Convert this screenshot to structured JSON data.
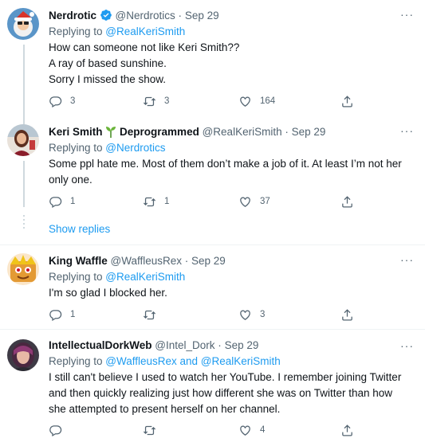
{
  "colors": {
    "accent": "#1d9bf0",
    "muted": "#536471",
    "text": "#0f1419"
  },
  "tweets": [
    {
      "name": "Nerdrotic",
      "handle": "@Nerdrotics",
      "dot": "·",
      "date": "Sep 29",
      "reply_prefix": "Replying to ",
      "reply_to": "@RealKeriSmith",
      "lines": [
        "How can someone not like Keri Smith??",
        "A ray of based sunshine.",
        "Sorry I missed the show."
      ],
      "replies": "3",
      "retweets": "3",
      "likes": "164",
      "badge": "verified-icon"
    },
    {
      "name": "Keri Smith",
      "name_suffix": "Deprogrammed",
      "handle": "@RealKeriSmith",
      "dot": "·",
      "date": "Sep 29",
      "reply_prefix": "Replying to ",
      "reply_to": "@Nerdrotics",
      "lines": [
        "Some ppl hate me. Most of them don’t make a job of it. At least I’m not her",
        "only one."
      ],
      "replies": "1",
      "retweets": "1",
      "likes": "37"
    },
    {
      "name": "King Waffle",
      "handle": "@WaffleusRex",
      "dot": "·",
      "date": "Sep 29",
      "reply_prefix": "Replying to ",
      "reply_to": "@RealKeriSmith",
      "lines": [
        "I'm so glad I blocked her."
      ],
      "replies": "1",
      "retweets": "",
      "likes": "3"
    },
    {
      "name": "IntellectualDorkWeb",
      "handle": "@Intel_Dork",
      "dot": "·",
      "date": "Sep 29",
      "reply_prefix": "Replying to ",
      "reply_to": "@WaffleusRex and @RealKeriSmith",
      "lines": [
        "I still can't believe I used to watch her YouTube. I remember joining Twitter",
        "and then quickly realizing just how different she was on Twitter than how",
        "she attempted to present herself on her channel."
      ],
      "replies": "",
      "retweets": "",
      "likes": "4"
    }
  ],
  "show_replies": "Show replies",
  "more_label": "···"
}
